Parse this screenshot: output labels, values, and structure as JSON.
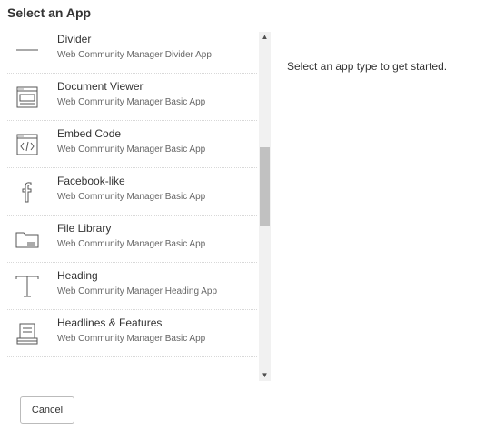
{
  "dialog": {
    "title": "Select an App",
    "prompt": "Select an app type to get started.",
    "cancel_label": "Cancel"
  },
  "apps": [
    {
      "name": "Divider",
      "description": "Web Community Manager Divider App",
      "icon": "divider-icon"
    },
    {
      "name": "Document Viewer",
      "description": "Web Community Manager Basic App",
      "icon": "document-viewer-icon"
    },
    {
      "name": "Embed Code",
      "description": "Web Community Manager Basic App",
      "icon": "embed-code-icon"
    },
    {
      "name": "Facebook-like",
      "description": "Web Community Manager Basic App",
      "icon": "facebook-icon"
    },
    {
      "name": "File Library",
      "description": "Web Community Manager Basic App",
      "icon": "folder-icon"
    },
    {
      "name": "Heading",
      "description": "Web Community Manager Heading App",
      "icon": "heading-icon"
    },
    {
      "name": "Headlines & Features",
      "description": "Web Community Manager Basic App",
      "icon": "headlines-icon"
    }
  ],
  "scrollbar": {
    "up_arrow": "▲",
    "down_arrow": "▼"
  }
}
